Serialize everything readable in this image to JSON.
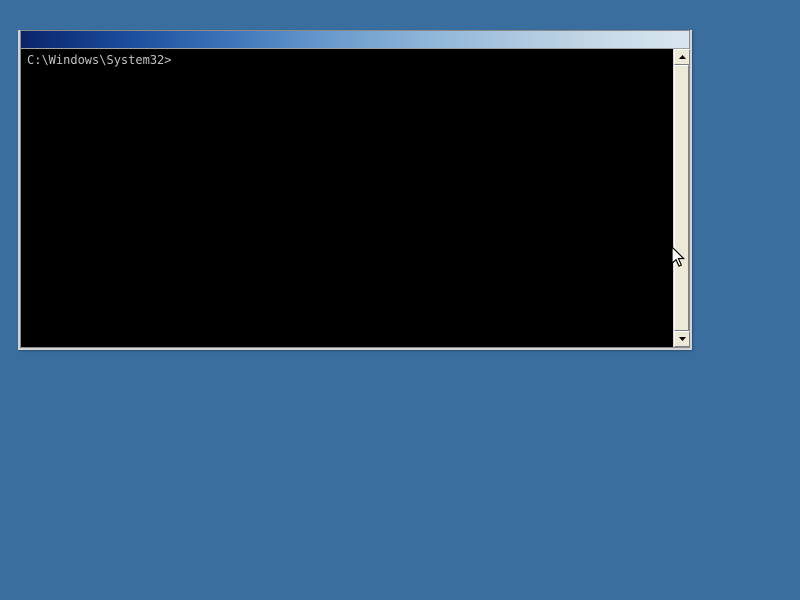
{
  "terminal": {
    "prompt": "C:\\Windows\\System32>"
  }
}
